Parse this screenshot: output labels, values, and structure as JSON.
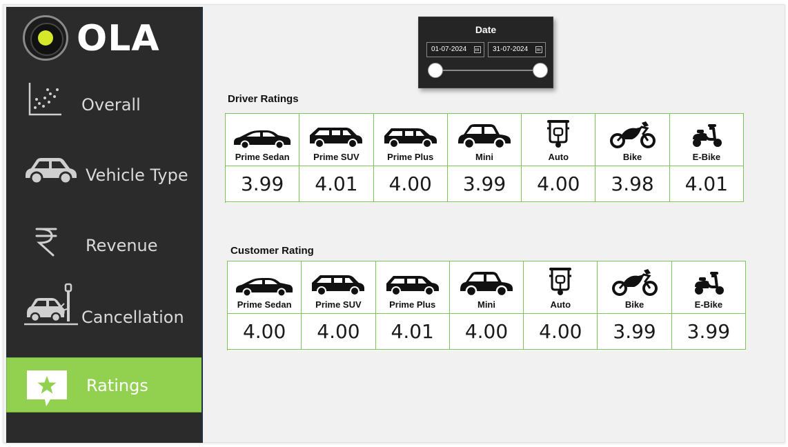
{
  "app": {
    "brand": "OLA"
  },
  "sidebar": {
    "items": [
      {
        "label": "Overall",
        "icon": "scatter-chart-icon",
        "active": false
      },
      {
        "label": "Vehicle Type",
        "icon": "car-icon",
        "active": false
      },
      {
        "label": "Revenue",
        "icon": "rupee-icon",
        "active": false
      },
      {
        "label": "Cancellation",
        "icon": "car-crash-icon",
        "active": false
      },
      {
        "label": "Ratings",
        "icon": "star-badge-icon",
        "active": true
      }
    ]
  },
  "date_slicer": {
    "title": "Date",
    "start": "01-07-2024",
    "end": "31-07-2024"
  },
  "driver_ratings": {
    "title": "Driver Ratings",
    "columns": [
      {
        "label": "Prime Sedan",
        "icon": "sedan-icon",
        "value": "3.99"
      },
      {
        "label": "Prime SUV",
        "icon": "suv-icon",
        "value": "4.01"
      },
      {
        "label": "Prime Plus",
        "icon": "prime-plus-car-icon",
        "value": "4.00"
      },
      {
        "label": "Mini",
        "icon": "hatchback-icon",
        "value": "3.99"
      },
      {
        "label": "Auto",
        "icon": "auto-rickshaw-icon",
        "value": "4.00"
      },
      {
        "label": "Bike",
        "icon": "motorbike-icon",
        "value": "3.98"
      },
      {
        "label": "E-Bike",
        "icon": "scooter-icon",
        "value": "4.01"
      }
    ]
  },
  "customer_ratings": {
    "title": "Customer Rating",
    "columns": [
      {
        "label": "Prime Sedan",
        "icon": "sedan-icon",
        "value": "4.00"
      },
      {
        "label": "Prime SUV",
        "icon": "suv-icon",
        "value": "4.00"
      },
      {
        "label": "Prime Plus",
        "icon": "prime-plus-car-icon",
        "value": "4.01"
      },
      {
        "label": "Mini",
        "icon": "hatchback-icon",
        "value": "4.00"
      },
      {
        "label": "Auto",
        "icon": "auto-rickshaw-icon",
        "value": "4.00"
      },
      {
        "label": "Bike",
        "icon": "motorbike-icon",
        "value": "3.99"
      },
      {
        "label": "E-Bike",
        "icon": "scooter-icon",
        "value": "3.99"
      }
    ]
  },
  "colors": {
    "sidebar_bg": "#2b2b2b",
    "active_green": "#92d050",
    "table_border": "#7cc453",
    "canvas_bg": "#f1f1f1"
  }
}
